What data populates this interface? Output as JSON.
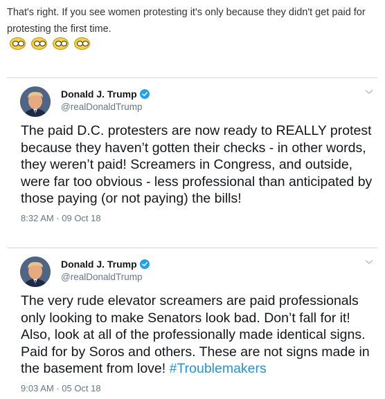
{
  "post": {
    "text": "That's right. If you see women protesting it's only because they didn't get paid for protesting the first time.",
    "emojis": [
      "money-face-emoji",
      "money-face-emoji",
      "money-face-emoji",
      "money-face-emoji"
    ]
  },
  "tweets": [
    {
      "name": "Donald J. Trump",
      "handle": "@realDonaldTrump",
      "body": "The paid D.C. protesters are now ready to REALLY protest because they haven’t gotten their checks - in other words, they weren’t paid! Screamers in Congress, and outside, were far too obvious - less professional than anticipated by those paying (or not paying) the bills!",
      "timestamp": "8:32 AM · 09 Oct 18"
    },
    {
      "name": "Donald J. Trump",
      "handle": "@realDonaldTrump",
      "body": "The very rude elevator screamers are paid professionals only looking to make Senators look bad. Don’t fall for it! Also, look at all of the professionally made identical signs. Paid for by Soros and others. These are not signs made in the basement from love! ",
      "hashtag": "#Troublemakers",
      "timestamp": "9:03 AM · 05 Oct 18"
    }
  ],
  "colors": {
    "verified": "#1da1f2",
    "hashtag": "#1b95e0",
    "secondary_text": "#657786",
    "divider": "#d6d9dc"
  }
}
